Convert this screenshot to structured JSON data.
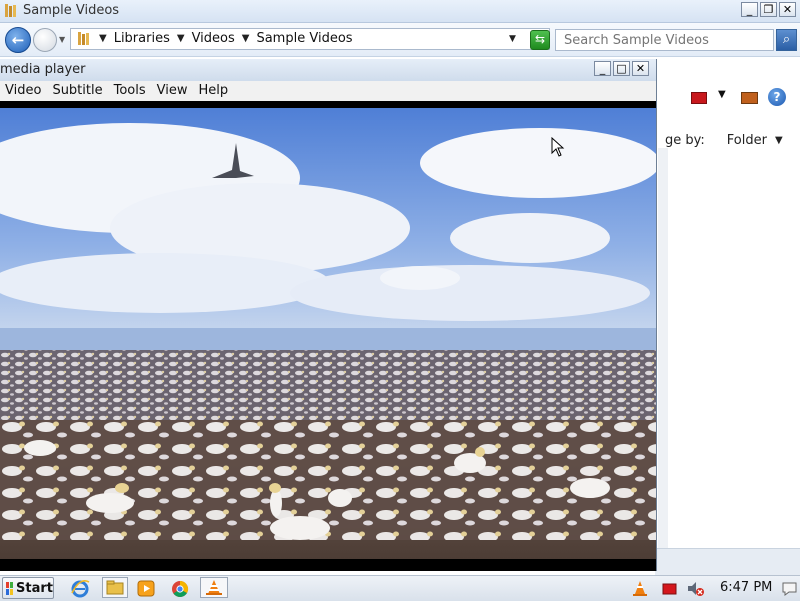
{
  "explorer": {
    "title": "Sample Videos",
    "breadcrumb": [
      "Libraries",
      "Videos",
      "Sample Videos"
    ],
    "search_placeholder": "Search Sample Videos",
    "arrange_label": "ge by:",
    "arrange_value": "Folder"
  },
  "player": {
    "title": "media player",
    "menu": [
      "Video",
      "Subtitle",
      "Tools",
      "View",
      "Help"
    ]
  },
  "taskbar": {
    "start_label": "Start",
    "clock": "6:47 PM"
  },
  "icons": {
    "back": "back-arrow-icon",
    "forward": "forward-arrow-icon",
    "search": "magnifier-icon",
    "help": "question-icon",
    "ie": "internet-explorer-icon",
    "vlc": "vlc-cone-icon"
  },
  "colors": {
    "accent": "#1d5fb8",
    "titlebar": "#d6e3f3",
    "vlc_orange": "#f07f10"
  }
}
